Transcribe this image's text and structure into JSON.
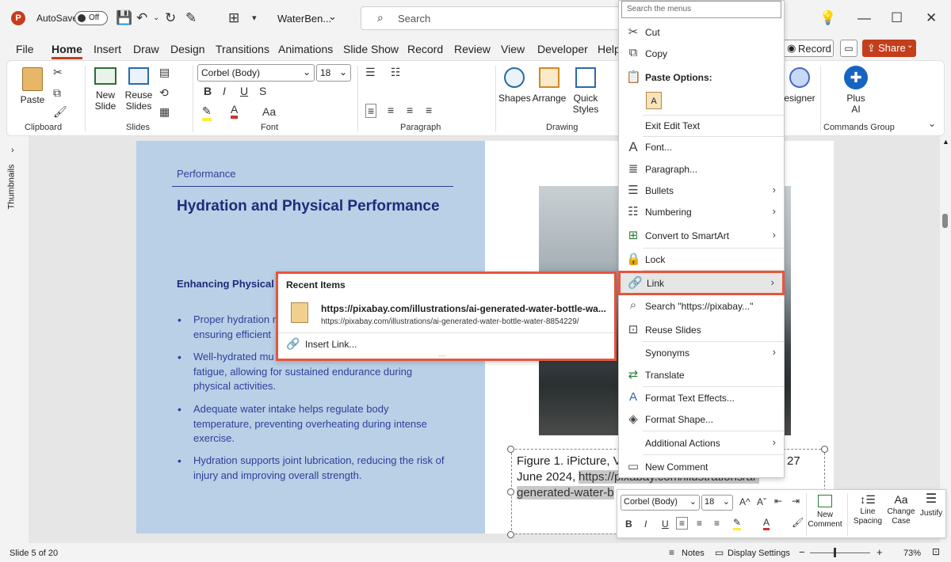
{
  "titlebar": {
    "autosave_label": "AutoSave",
    "autosave_state": "Off",
    "file_name": "WaterBen...",
    "search_placeholder": "Search"
  },
  "tabs": [
    "File",
    "Home",
    "Insert",
    "Draw",
    "Design",
    "Transitions",
    "Animations",
    "Slide Show",
    "Record",
    "Review",
    "View",
    "Developer",
    "Help"
  ],
  "ribbon_right": {
    "record": "Record",
    "share": "Share"
  },
  "ribbon": {
    "paste": "Paste",
    "clipboard": "Clipboard",
    "new_slide_1": "New",
    "new_slide_2": "Slide",
    "reuse_1": "Reuse",
    "reuse_2": "Slides",
    "slides": "Slides",
    "font_name": "Corbel (Body)",
    "font_size": "18",
    "font": "Font",
    "paragraph": "Paragraph",
    "shapes": "Shapes",
    "arrange": "Arrange",
    "quick_1": "Quick",
    "quick_2": "Styles",
    "drawing": "Drawing",
    "designer": "esigner",
    "plus_1": "Plus",
    "plus_2": "AI",
    "commands_group": "Commands Group"
  },
  "thumbnails_label": "Thumbnails",
  "slide": {
    "section": "Performance",
    "title": "Hydration and Physical Performance",
    "subheading": "Enhancing Physical",
    "bullets": [
      [
        "Proper hydration m",
        "ensuring efficient"
      ],
      [
        "Well-hydrated mu",
        "fatigue, allowing for sustained endurance during",
        "physical activities."
      ],
      [
        "Adequate water intake helps regulate body",
        "temperature, preventing overheating during intense",
        "exercise."
      ],
      [
        "Hydration supports joint lubrication, reducing the risk of",
        "injury and improving overall strength."
      ]
    ],
    "caption_1a": "Figure 1. iPicture, V",
    "caption_1b": "27",
    "caption_2a": "June 2024, ",
    "caption_2b": "https://pixabay.com/illustrations/ai-",
    "caption_3": "generated-water-b"
  },
  "context_menu": {
    "search_placeholder": "Search the menus",
    "items": {
      "cut": "Cut",
      "copy": "Copy",
      "paste_options": "Paste Options:",
      "exit_edit": "Exit Edit Text",
      "font": "Font...",
      "paragraph": "Paragraph...",
      "bullets": "Bullets",
      "numbering": "Numbering",
      "smartart": "Convert to SmartArt",
      "lock": "Lock",
      "link": "Link",
      "search": "Search \"https://pixabay...\"",
      "reuse": "Reuse Slides",
      "synonyms": "Synonyms",
      "translate": "Translate",
      "text_effects": "Format Text Effects...",
      "format_shape": "Format Shape...",
      "additional": "Additional Actions",
      "comment": "New Comment"
    }
  },
  "submenu": {
    "header": "Recent Items",
    "url_bold": "https://pixabay.com/illustrations/ai-generated-water-bottle-wa...",
    "url_full": "https://pixabay.com/illustrations/ai-generated-water-bottle-water-8854229/",
    "insert_link": "Insert Link..."
  },
  "mini_toolbar": {
    "font_name": "Corbel (Body)",
    "font_size": "18",
    "new_comment_1": "New",
    "new_comment_2": "Comment",
    "line_1": "Line",
    "line_2": "Spacing",
    "case_1": "Change",
    "case_2": "Case",
    "justify": "Justify"
  },
  "status": {
    "slide_info": "Slide 5 of 20",
    "notes": "Notes",
    "display": "Display Settings",
    "zoom": "73%"
  },
  "colors": {
    "accent": "#c43e1c",
    "share_bg": "#c43e1c",
    "highlight": "#e8553e",
    "slide_blue": "#b9d0e6",
    "text_blue": "#1f2a7a"
  }
}
